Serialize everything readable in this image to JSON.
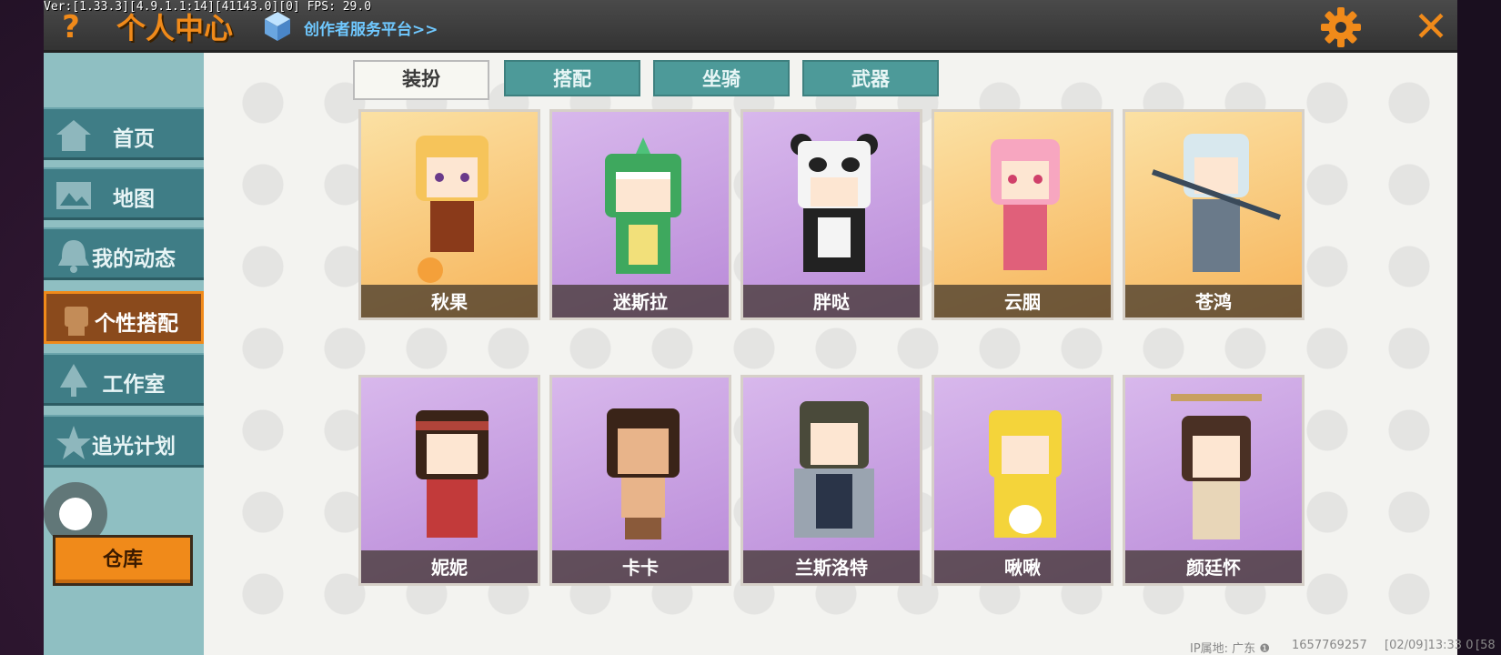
{
  "debug": {
    "text": "Ver:[1.33.3][4.9.1.1:14][41143.0][0] FPS: 29.0"
  },
  "header": {
    "help_glyph": "?",
    "title": "个人中心",
    "creator_link": "创作者服务平台>>",
    "close_glyph": "✕"
  },
  "sidebar": {
    "items": [
      {
        "label": "首页",
        "icon": "house-icon",
        "active": false
      },
      {
        "label": "地图",
        "icon": "map-icon",
        "active": false
      },
      {
        "label": "我的动态",
        "icon": "bell-icon",
        "active": false
      },
      {
        "label": "个性搭配",
        "icon": "character-icon",
        "active": true
      },
      {
        "label": "工作室",
        "icon": "tree-icon",
        "active": false
      },
      {
        "label": "追光计划",
        "icon": "star-icon",
        "active": false
      }
    ],
    "warehouse_label": "仓库"
  },
  "tabs": [
    {
      "label": "装扮",
      "active": true
    },
    {
      "label": "搭配",
      "active": false
    },
    {
      "label": "坐骑",
      "active": false
    },
    {
      "label": "武器",
      "active": false
    }
  ],
  "skins_row1": [
    {
      "name": "秋果",
      "bg": "orange"
    },
    {
      "name": "迷斯拉",
      "bg": "purple"
    },
    {
      "name": "胖哒",
      "bg": "purple"
    },
    {
      "name": "云胭",
      "bg": "orange"
    },
    {
      "name": "苍鸿",
      "bg": "orange"
    }
  ],
  "skins_row2": [
    {
      "name": "妮妮",
      "bg": "purple"
    },
    {
      "name": "卡卡",
      "bg": "purple"
    },
    {
      "name": "兰斯洛特",
      "bg": "purple"
    },
    {
      "name": "啾啾",
      "bg": "purple"
    },
    {
      "name": "颜廷怀",
      "bg": "purple"
    }
  ],
  "footer": {
    "ip_location": "IP属地: 广东 ❶",
    "uid": "1657769257",
    "timestamp": "[02/09]13:33 0",
    "extra": "[58"
  },
  "colors": {
    "accent_orange": "#f08a1a",
    "sidebar_teal": "#3f7d86",
    "tab_teal": "#4d9a99",
    "link_blue": "#6fc8ff"
  }
}
